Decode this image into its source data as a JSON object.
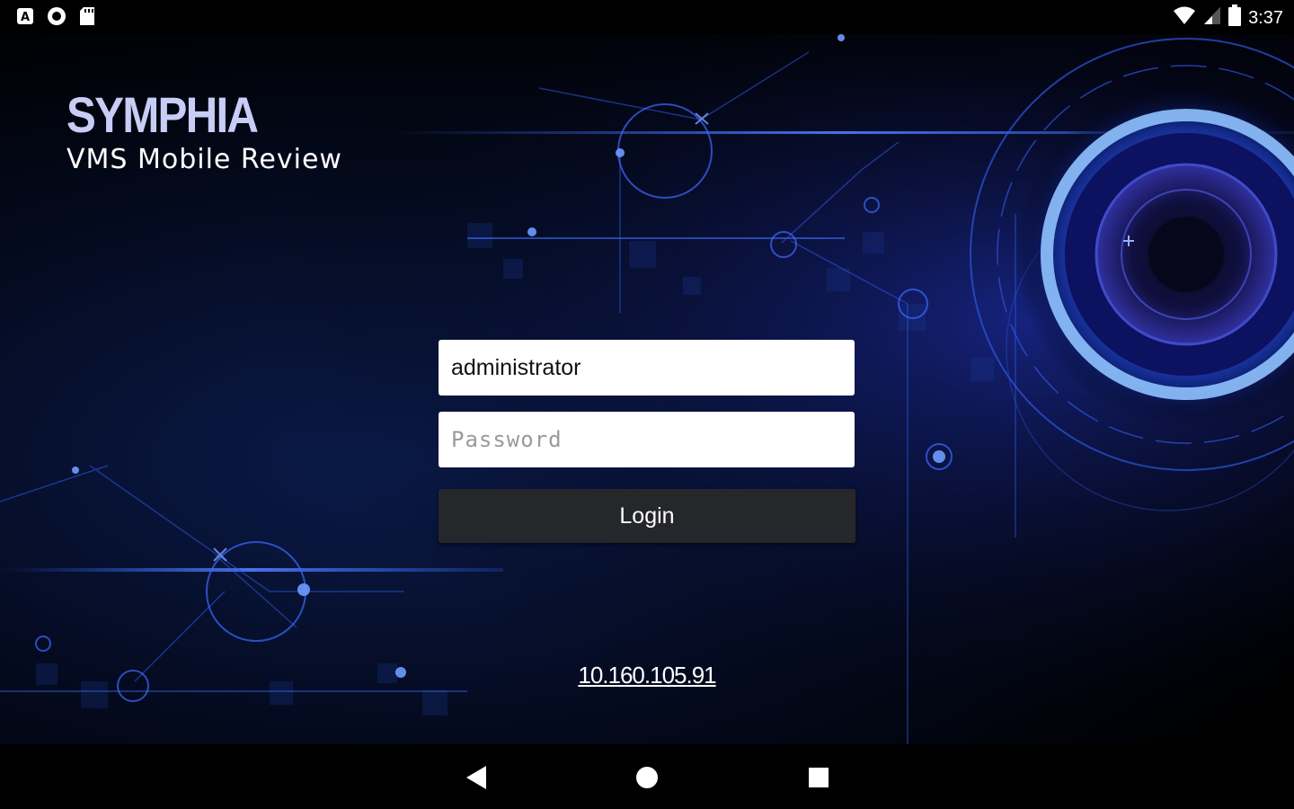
{
  "status_bar": {
    "time": "3:37",
    "left_icons": [
      "a-notification-icon",
      "circle-notification-icon",
      "sd-card-icon"
    ],
    "right_icons": [
      "wifi-icon",
      "cell-signal-icon",
      "battery-icon"
    ]
  },
  "branding": {
    "title": "SYMPHIA",
    "subtitle": "VMS Mobile Review"
  },
  "login_form": {
    "username_value": "administrator",
    "password_placeholder": "Password",
    "login_label": "Login"
  },
  "server": {
    "address": "10.160.105.91"
  },
  "nav_bar": {
    "icons": [
      "back-icon",
      "home-icon",
      "recents-icon"
    ]
  },
  "colors": {
    "title": "#c8cdf5",
    "button": "#25272b",
    "accent_blue": "#2f6bff"
  }
}
